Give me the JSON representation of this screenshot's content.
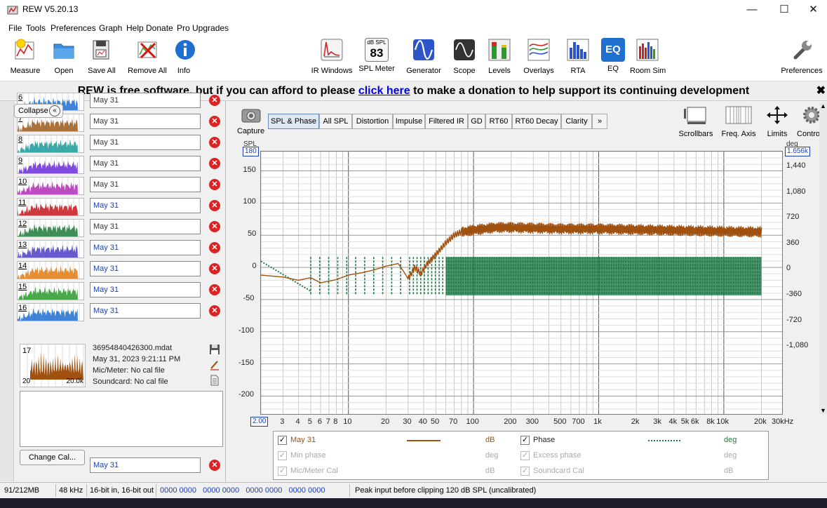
{
  "window": {
    "title": "REW V5.20.13"
  },
  "menu": [
    "File",
    "Tools",
    "Preferences",
    "Graph",
    "Help",
    "Donate",
    "Pro Upgrades"
  ],
  "toolbar": {
    "left": [
      "Measure",
      "Open",
      "Save All",
      "Remove All",
      "Info"
    ],
    "center": [
      "IR Windows",
      "SPL Meter",
      "Generator",
      "Scope",
      "Levels",
      "Overlays",
      "RTA",
      "EQ",
      "Room Sim"
    ],
    "right": "Preferences",
    "spl_meter_small": "dB SPL",
    "spl_meter_value": "83",
    "eq_icon_text": "EQ"
  },
  "banner": {
    "before": "REW is free software, but if you can afford to please ",
    "link": "click here",
    "after": " to make a donation to help support its continuing development",
    "close": "✖"
  },
  "panel": {
    "collapse_label": "Collapse",
    "measurements": [
      {
        "num": "6",
        "name": "May 31",
        "color": "#1f6fd1",
        "active": false
      },
      {
        "num": "7",
        "name": "May 31",
        "color": "#9b5a1a",
        "active": false
      },
      {
        "num": "8",
        "name": "May 31",
        "color": "#1a9a9a",
        "active": false
      },
      {
        "num": "9",
        "name": "May 31",
        "color": "#6a2bd8",
        "active": false
      },
      {
        "num": "10",
        "name": "May 31",
        "color": "#b12bb8",
        "active": false
      },
      {
        "num": "11",
        "name": "May 31",
        "color": "#c4161c",
        "active": true
      },
      {
        "num": "12",
        "name": "May 31",
        "color": "#1c7a3a",
        "active": false
      },
      {
        "num": "13",
        "name": "May 31",
        "color": "#4b3fc8",
        "active": true
      },
      {
        "num": "14",
        "name": "May 31",
        "color": "#e07a10",
        "active": true
      },
      {
        "num": "15",
        "name": "May 31",
        "color": "#2a9a2a",
        "active": true
      },
      {
        "num": "16",
        "name": "May 31",
        "color": "#1f6fd1",
        "active": true
      }
    ],
    "selected": {
      "num": "17",
      "file": "36954840426300.mdat",
      "date": "May 31, 2023 9:21:11 PM",
      "mic": "Mic/Meter: No cal file",
      "soundcard": "Soundcard: No cal file",
      "thumb_left_label": "20",
      "thumb_right_label": "20.0k",
      "name": "May 31"
    },
    "change_cal": "Change Cal..."
  },
  "graph": {
    "capture_label": "Capture",
    "tabs": [
      "SPL & Phase",
      "All SPL",
      "Distortion",
      "Impulse",
      "Filtered IR",
      "GD",
      "RT60",
      "RT60 Decay",
      "Clarity",
      "»"
    ],
    "right_tools": [
      "Scrollbars",
      "Freq. Axis",
      "Limits",
      "Controls"
    ],
    "left_unit": "SPL",
    "right_unit": "deg",
    "left_top_chip": "180",
    "right_top_chip": "1.656k",
    "x_start_chip": "2.00",
    "x_end_label": "30kHz"
  },
  "chart_data": {
    "type": "line",
    "x_scale": "log",
    "xlim": [
      2,
      30000
    ],
    "ylim": [
      -230,
      180
    ],
    "y2lim": [
      -2040,
      1656
    ],
    "grid": true,
    "x_ticks": [
      "3",
      "4",
      "5",
      "6",
      "7",
      "8",
      "10",
      "20",
      "30",
      "40",
      "50",
      "70",
      "100",
      "200",
      "300",
      "500",
      "700",
      "1k",
      "2k",
      "3k",
      "4k",
      "5k",
      "6k",
      "8k",
      "10k",
      "20k"
    ],
    "x_tick_values": [
      3,
      4,
      5,
      6,
      7,
      8,
      10,
      20,
      30,
      40,
      50,
      70,
      100,
      200,
      300,
      500,
      700,
      1000,
      2000,
      3000,
      4000,
      5000,
      6000,
      8000,
      10000,
      20000
    ],
    "y_ticks": [
      "150",
      "100",
      "50",
      "0",
      "-50",
      "-100",
      "-150",
      "-200"
    ],
    "y_tick_values": [
      150,
      100,
      50,
      0,
      -50,
      -100,
      -150,
      -200
    ],
    "y2_ticks": [
      "1,440",
      "1,080",
      "720",
      "360",
      "0",
      "-360",
      "-720",
      "-1,080"
    ],
    "y2_tick_values": [
      1440,
      1080,
      720,
      360,
      0,
      -360,
      -720,
      -1080
    ],
    "series": [
      {
        "name": "May 31",
        "unit": "dB",
        "color": "#a0500f",
        "x": [
          2,
          3,
          4,
          5,
          6,
          8,
          10,
          13,
          16,
          20,
          25,
          28,
          30,
          34,
          38,
          42,
          50,
          60,
          70,
          80,
          100,
          150,
          200,
          500,
          1000,
          3000,
          10000,
          20000
        ],
        "y": [
          -12,
          -15,
          -20,
          -16,
          -24,
          -19,
          -12,
          -8,
          -4,
          2,
          6,
          -8,
          -18,
          0,
          -10,
          4,
          20,
          38,
          50,
          55,
          58,
          62,
          62,
          60,
          60,
          58,
          56,
          55
        ],
        "ripple": 9
      },
      {
        "name": "Phase",
        "unit": "deg",
        "color": "#1e7a44",
        "style": "dotted",
        "x_start": 2,
        "x_end": 20000,
        "band": [
          -360,
          180
        ]
      }
    ],
    "legend": [
      {
        "name": "May 31",
        "unit": "dB",
        "checked": true,
        "enabled": true
      },
      {
        "name": "Phase",
        "unit": "deg",
        "checked": true,
        "enabled": true
      },
      {
        "name": "Min phase",
        "unit": "deg",
        "checked": true,
        "enabled": false
      },
      {
        "name": "Excess phase",
        "unit": "deg",
        "checked": true,
        "enabled": false
      },
      {
        "name": "Mic/Meter Cal",
        "unit": "dB",
        "checked": true,
        "enabled": false
      },
      {
        "name": "Soundcard Cal",
        "unit": "dB",
        "checked": true,
        "enabled": false
      }
    ]
  },
  "status": {
    "memory": "91/212MB",
    "rate": "48 kHz",
    "bits": "16-bit in, 16-bit out",
    "levels": "0000 0000   0000 0000   0000 0000   0000 0000",
    "message": "Peak input before clipping 120 dB SPL (uncalibrated)"
  }
}
